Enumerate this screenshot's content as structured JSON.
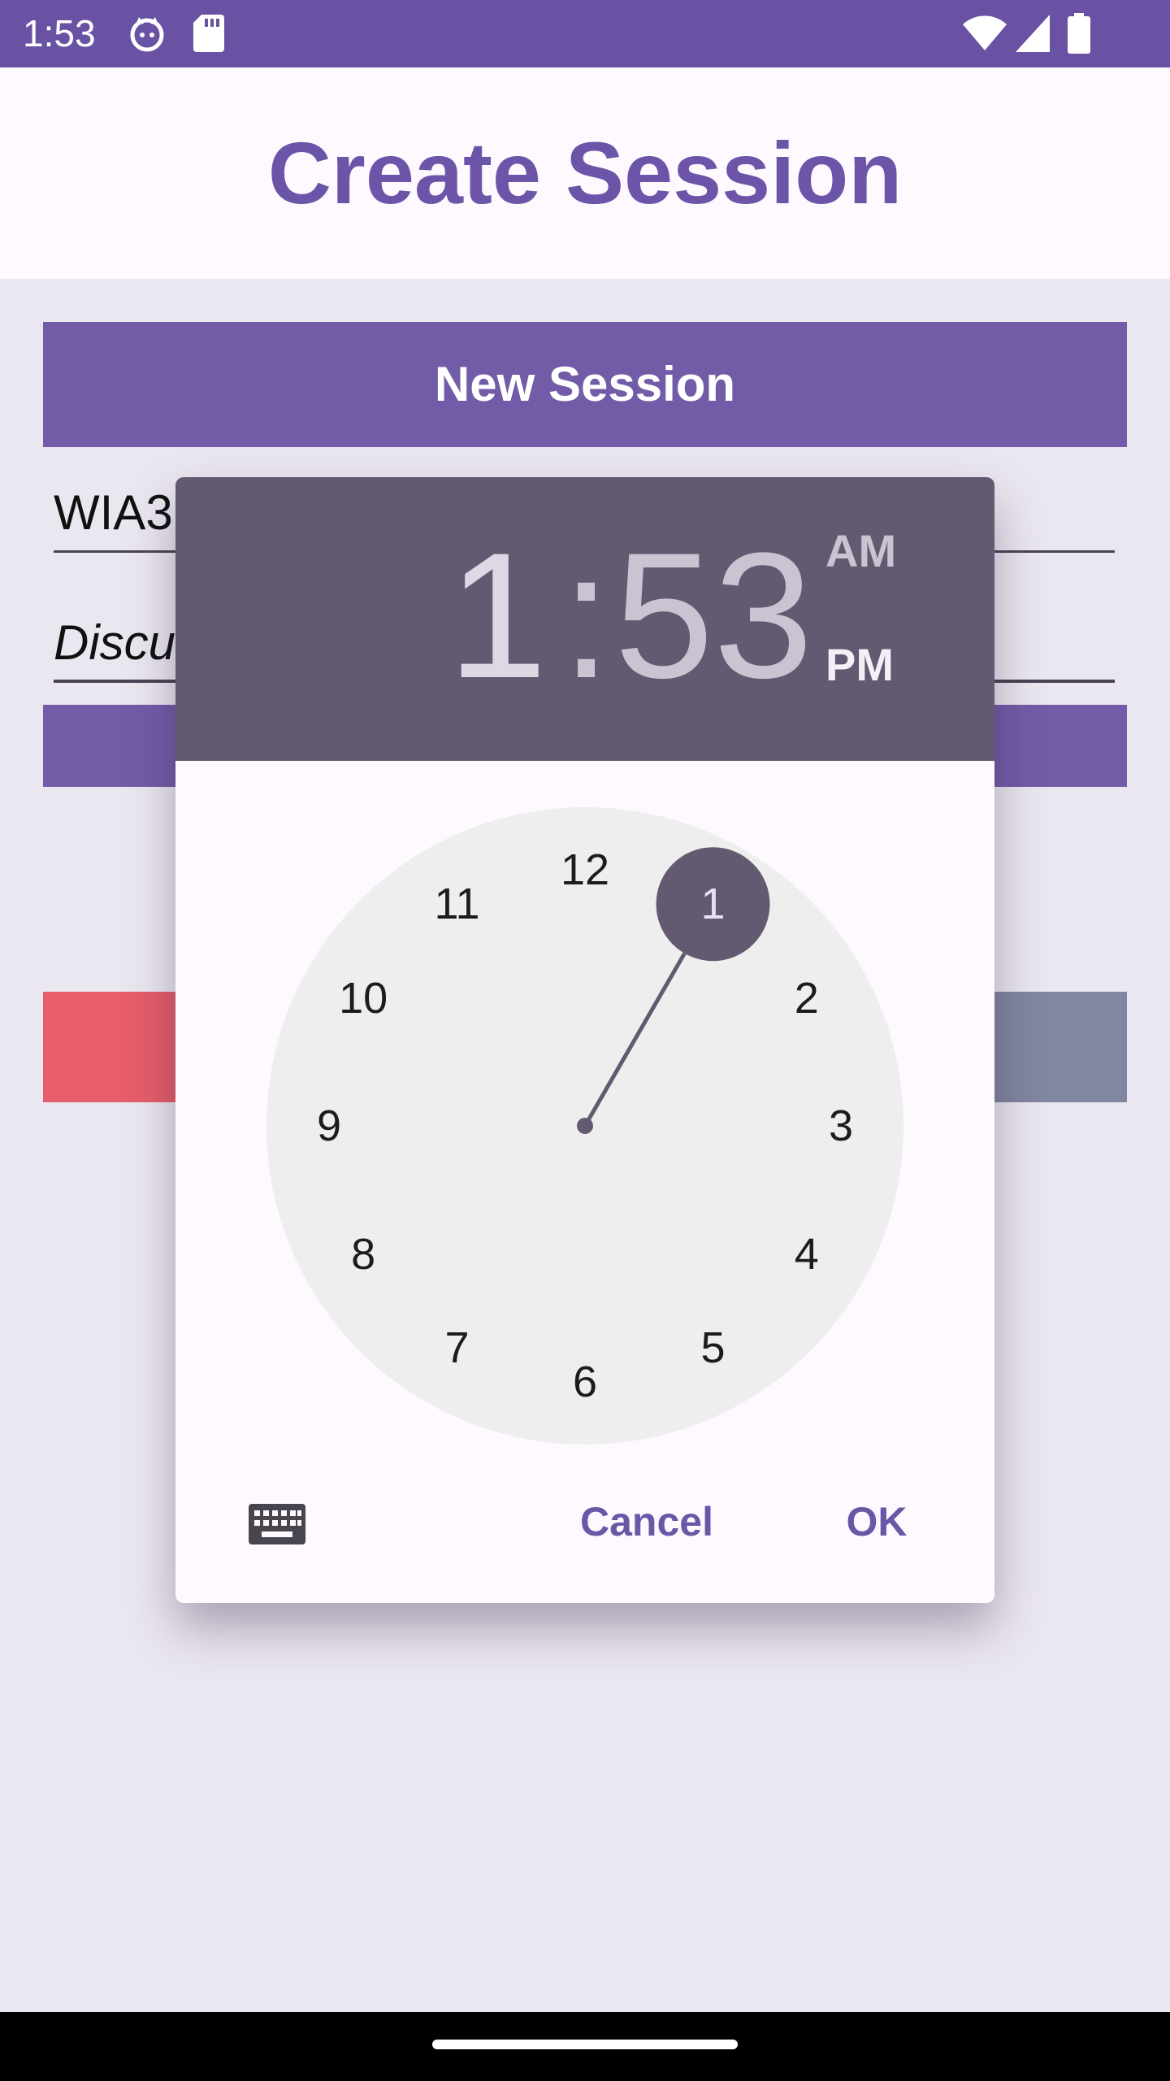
{
  "status_bar": {
    "time": "1:53",
    "icons": [
      "cat-icon",
      "sd-card-icon",
      "wifi-icon",
      "signal-icon",
      "battery-icon"
    ]
  },
  "app_bar": {
    "title": "Create Session"
  },
  "background": {
    "new_session_label": "New Session",
    "field1_value": "WIA3",
    "field2_value": "Discu"
  },
  "time_picker": {
    "hour": "1",
    "separator": ":",
    "minute": "53",
    "am_label": "AM",
    "pm_label": "PM",
    "selected_period": "PM",
    "selected_hour": 1,
    "dial_numbers": [
      "12",
      "1",
      "2",
      "3",
      "4",
      "5",
      "6",
      "7",
      "8",
      "9",
      "10",
      "11"
    ],
    "keyboard_icon": "keyboard-icon",
    "cancel_label": "Cancel",
    "ok_label": "OK"
  },
  "colors": {
    "primary": "#6952a3",
    "header": "#635a71",
    "accent_text": "#6a58a6"
  }
}
